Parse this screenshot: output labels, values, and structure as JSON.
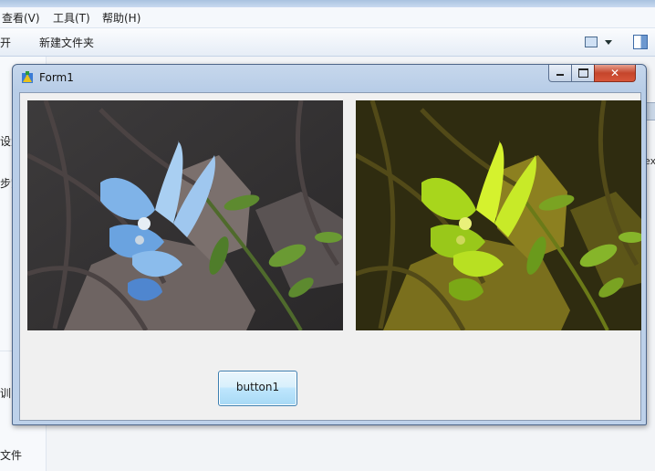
{
  "explorer": {
    "menu": [
      "查看(V)",
      "工具(T)",
      "帮助(H)"
    ],
    "toolbar": {
      "open_fragment": "开",
      "new_folder": "新建文件夹"
    },
    "nav_fragments": [
      "设置",
      "步空",
      "训",
      "文件"
    ],
    "right_fragment": "ex"
  },
  "form": {
    "title": "Form1",
    "button1_label": "button1",
    "original_image": "flower-photo-original",
    "processed_image": "flower-photo-yellow-tint"
  },
  "colors": {
    "window_frame": "#b8cde7",
    "client_bg": "#f0f0f0",
    "close_button": "#c5452b",
    "tint": "#c8c800"
  }
}
